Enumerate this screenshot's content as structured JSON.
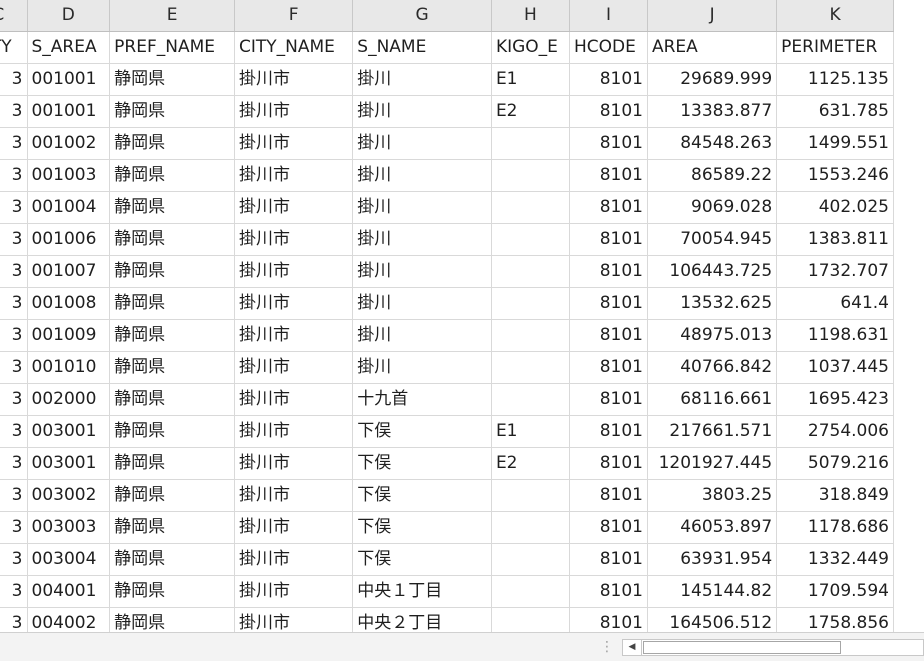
{
  "columns": {
    "letters": [
      "C",
      "D",
      "E",
      "F",
      "G",
      "H",
      "I",
      "J",
      "K"
    ]
  },
  "header_row": [
    "CITY",
    "S_AREA",
    "PREF_NAME",
    "CITY_NAME",
    "S_NAME",
    "KIGO_E",
    "HCODE",
    "AREA",
    "PERIMETER"
  ],
  "rows": [
    [
      "3",
      "001001",
      "静岡県",
      "掛川市",
      "掛川",
      "E1",
      "8101",
      "29689.999",
      "1125.135"
    ],
    [
      "3",
      "001001",
      "静岡県",
      "掛川市",
      "掛川",
      "E2",
      "8101",
      "13383.877",
      "631.785"
    ],
    [
      "3",
      "001002",
      "静岡県",
      "掛川市",
      "掛川",
      "",
      "8101",
      "84548.263",
      "1499.551"
    ],
    [
      "3",
      "001003",
      "静岡県",
      "掛川市",
      "掛川",
      "",
      "8101",
      "86589.22",
      "1553.246"
    ],
    [
      "3",
      "001004",
      "静岡県",
      "掛川市",
      "掛川",
      "",
      "8101",
      "9069.028",
      "402.025"
    ],
    [
      "3",
      "001006",
      "静岡県",
      "掛川市",
      "掛川",
      "",
      "8101",
      "70054.945",
      "1383.811"
    ],
    [
      "3",
      "001007",
      "静岡県",
      "掛川市",
      "掛川",
      "",
      "8101",
      "106443.725",
      "1732.707"
    ],
    [
      "3",
      "001008",
      "静岡県",
      "掛川市",
      "掛川",
      "",
      "8101",
      "13532.625",
      "641.4"
    ],
    [
      "3",
      "001009",
      "静岡県",
      "掛川市",
      "掛川",
      "",
      "8101",
      "48975.013",
      "1198.631"
    ],
    [
      "3",
      "001010",
      "静岡県",
      "掛川市",
      "掛川",
      "",
      "8101",
      "40766.842",
      "1037.445"
    ],
    [
      "3",
      "002000",
      "静岡県",
      "掛川市",
      "十九首",
      "",
      "8101",
      "68116.661",
      "1695.423"
    ],
    [
      "3",
      "003001",
      "静岡県",
      "掛川市",
      "下俣",
      "E1",
      "8101",
      "217661.571",
      "2754.006"
    ],
    [
      "3",
      "003001",
      "静岡県",
      "掛川市",
      "下俣",
      "E2",
      "8101",
      "1201927.445",
      "5079.216"
    ],
    [
      "3",
      "003002",
      "静岡県",
      "掛川市",
      "下俣",
      "",
      "8101",
      "3803.25",
      "318.849"
    ],
    [
      "3",
      "003003",
      "静岡県",
      "掛川市",
      "下俣",
      "",
      "8101",
      "46053.897",
      "1178.686"
    ],
    [
      "3",
      "003004",
      "静岡県",
      "掛川市",
      "下俣",
      "",
      "8101",
      "63931.954",
      "1332.449"
    ],
    [
      "3",
      "004001",
      "静岡県",
      "掛川市",
      "中央１丁目",
      "",
      "8101",
      "145144.82",
      "1709.594"
    ],
    [
      "3",
      "004002",
      "静岡県",
      "掛川市",
      "中央２丁目",
      "",
      "8101",
      "164506.512",
      "1758.856"
    ]
  ],
  "numeric_columns": [
    6,
    7,
    8
  ],
  "statusbar": {
    "split_handle": "⋮",
    "scroll_left_arrow": "◀"
  }
}
